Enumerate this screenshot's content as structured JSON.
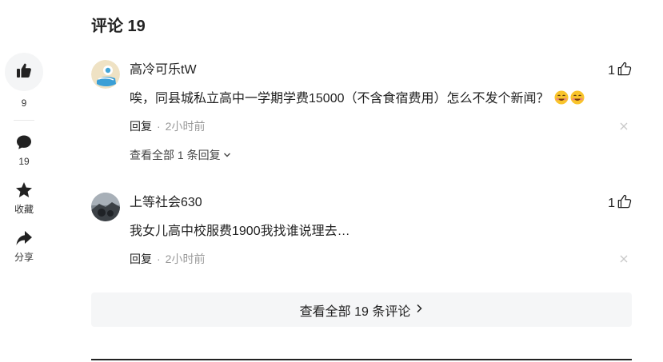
{
  "rail": {
    "like_count": "9",
    "comment_count": "19",
    "favorite_label": "收藏",
    "share_label": "分享"
  },
  "section": {
    "title": "评论 19"
  },
  "comments": [
    {
      "username": "高冷可乐tW",
      "likes": "1",
      "text": "唉，同县城私立高中一学期学费15000（不含食宿费用）怎么不发个新闻？",
      "emoji": "😅",
      "reply_label": "回复",
      "separator": "·",
      "time": "2小时前",
      "view_replies": "查看全部 1 条回复"
    },
    {
      "username": "上等社会630",
      "likes": "1",
      "text": "我女儿高中校服费1900我找谁说理去…",
      "reply_label": "回复",
      "separator": "·",
      "time": "2小时前"
    }
  ],
  "view_all": "查看全部 19 条评论",
  "colors": {
    "text": "#222222",
    "muted": "#999999",
    "panel": "#f5f6f7"
  }
}
